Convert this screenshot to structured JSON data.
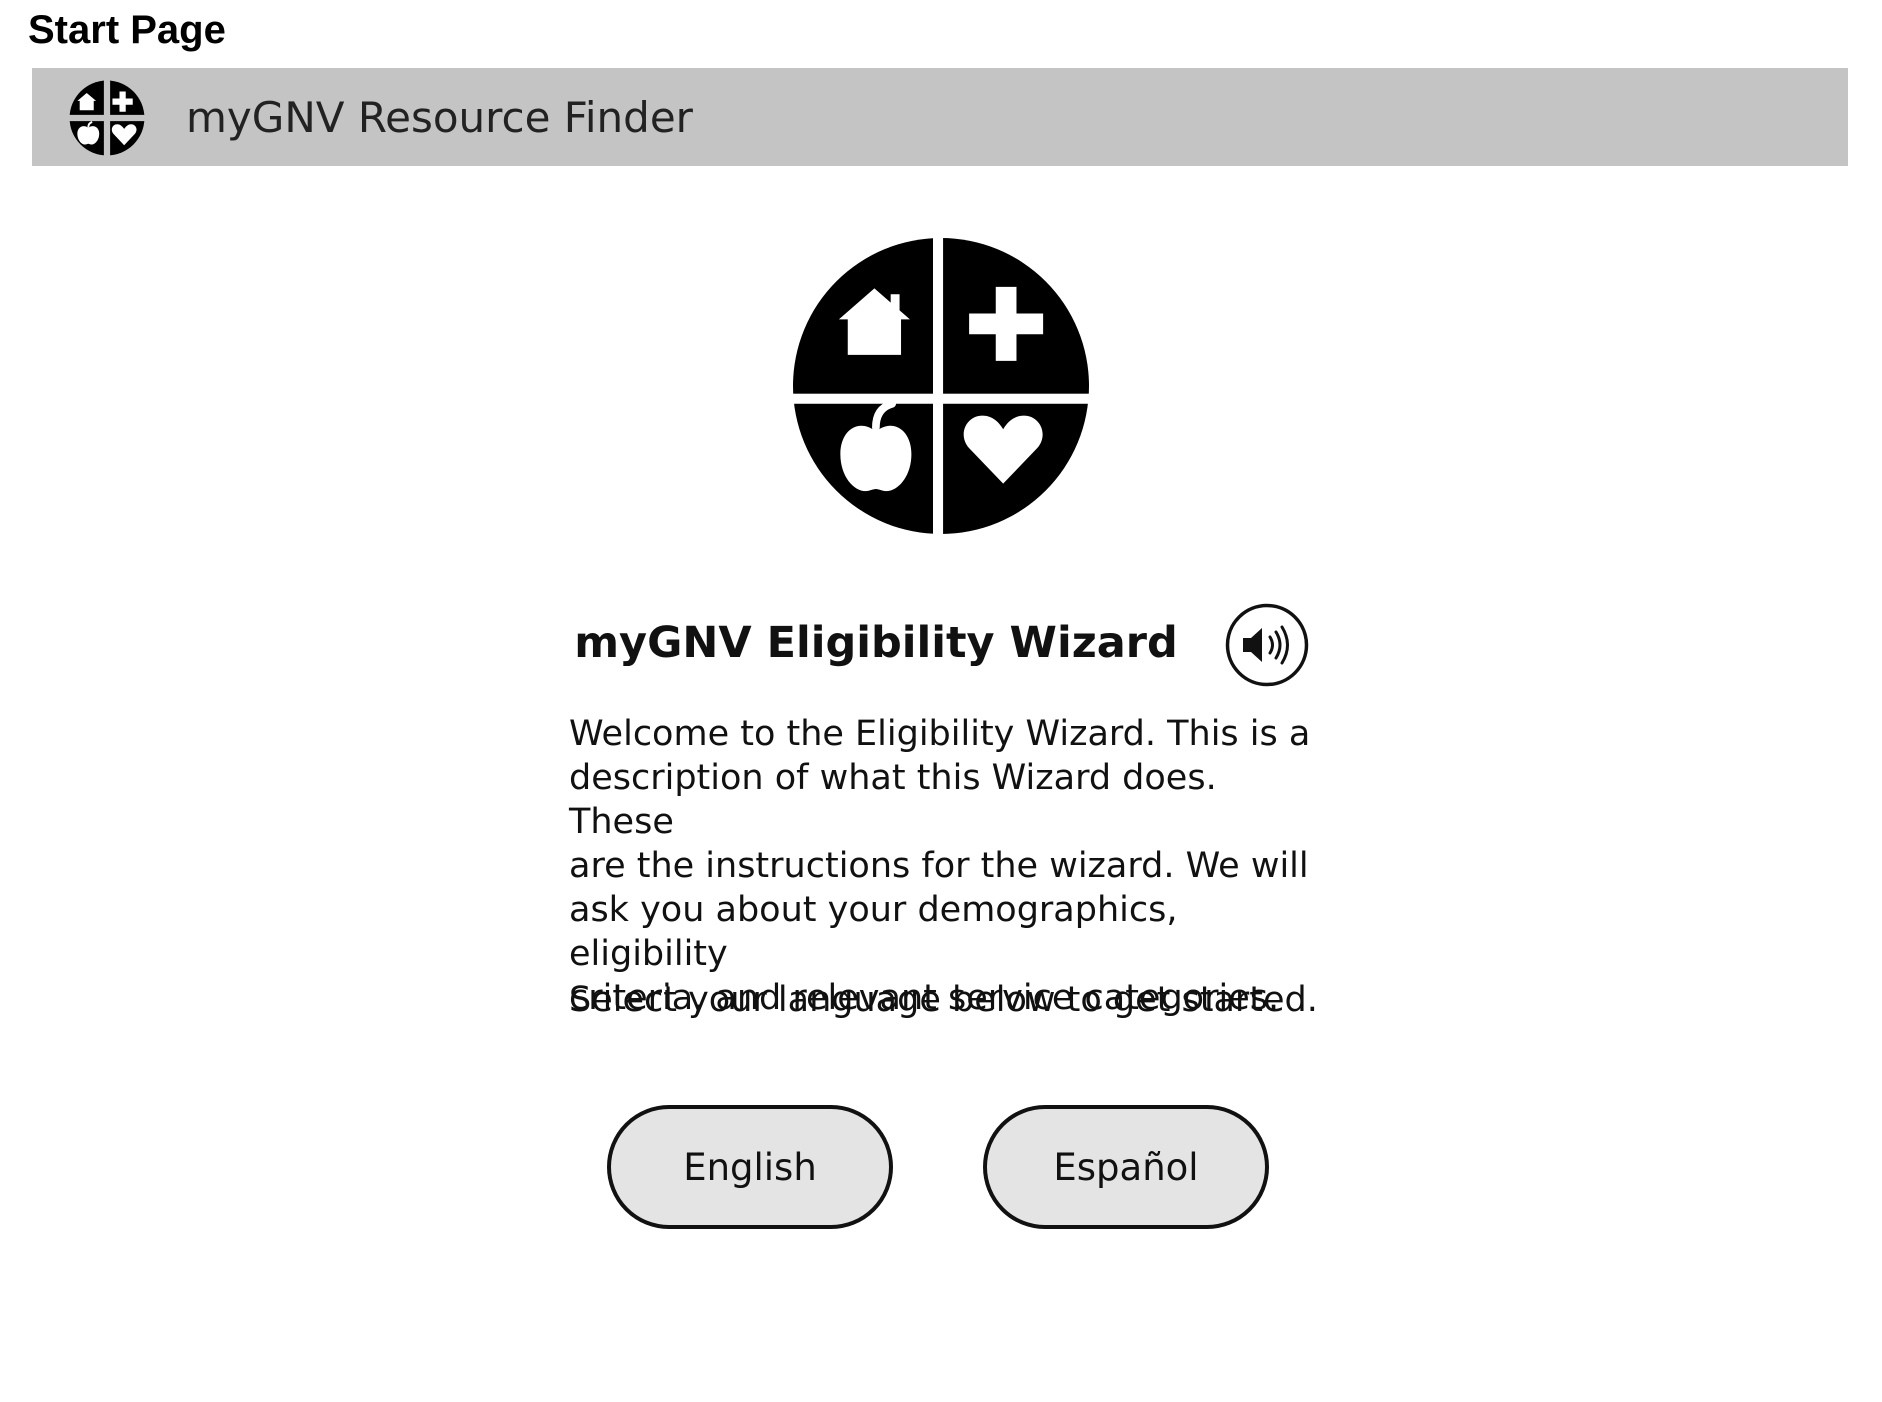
{
  "page_label": "Start Page",
  "app_bar": {
    "title": "myGNV Resource Finder",
    "background_color": "#c4c4c4",
    "logo_icon": "mygnv-logo-icon"
  },
  "hero": {
    "logo_icon": "mygnv-logo-icon",
    "quadrant_icons": [
      "house-icon",
      "plus-icon",
      "apple-icon",
      "heart-icon"
    ]
  },
  "wizard": {
    "title": "myGNV Eligibility Wizard",
    "audio_icon": "speaker-icon",
    "description": "Welcome to the Eligibility Wizard. This is a\ndescription of what this Wizard does. These\nare the instructions for the wizard. We will\nask you about your demographics, eligibility\ncriteria, and relevant service categories.",
    "instruction": "Select your language below to get started."
  },
  "language_buttons": [
    {
      "label": "English"
    },
    {
      "label": "Español"
    }
  ],
  "colors": {
    "button_fill": "#e4e4e4",
    "button_border": "#111111",
    "logo": "#000000"
  }
}
